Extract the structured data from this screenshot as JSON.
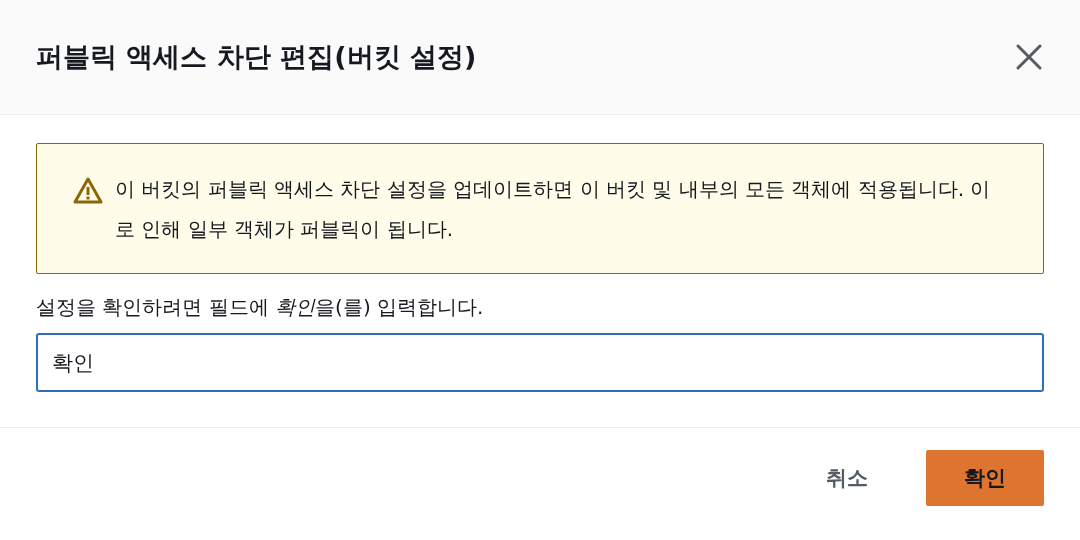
{
  "dialog": {
    "title": "퍼블릭 액세스 차단 편집(버킷 설정)",
    "warning": "이 버킷의 퍼블릭 액세스 차단 설정을 업데이트하면 이 버킷 및 내부의 모든 객체에 적용됩니다. 이로 인해 일부 객체가 퍼블릭이 됩니다.",
    "confirm_label": {
      "before": "설정을 확인하려면 필드에 ",
      "emphasis": "확인",
      "after": "을(를) 입력합니다."
    },
    "confirm_field": {
      "value": "확인",
      "focused": true
    },
    "buttons": [
      {
        "label": "취소",
        "kind": "secondary"
      },
      {
        "label": "확인",
        "kind": "primary"
      }
    ]
  }
}
